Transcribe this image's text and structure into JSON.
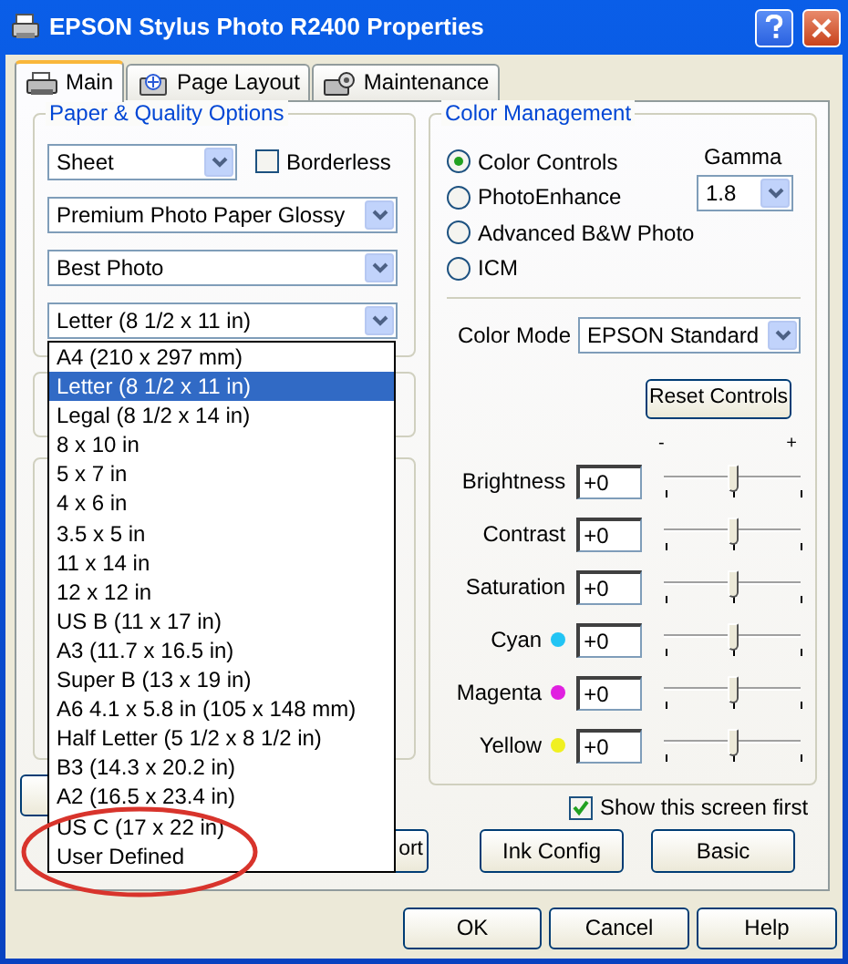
{
  "window": {
    "title": "EPSON Stylus Photo R2400 Properties"
  },
  "tabs": [
    {
      "label": "Main",
      "selected": true
    },
    {
      "label": "Page Layout",
      "selected": false
    },
    {
      "label": "Maintenance",
      "selected": false
    }
  ],
  "paper_quality": {
    "title": "Paper & Quality Options",
    "source": "Sheet",
    "borderless": {
      "label": "Borderless",
      "checked": false
    },
    "media_type": "Premium Photo Paper Glossy",
    "quality": "Best Photo",
    "paper_size": "Letter (8 1/2 x 11 in)",
    "paper_size_options": [
      {
        "label": "A4 (210 x 297 mm)",
        "selected": false
      },
      {
        "label": "Letter (8 1/2 x 11 in)",
        "selected": true
      },
      {
        "label": "Legal (8 1/2 x 14 in)",
        "selected": false
      },
      {
        "label": "8 x 10 in",
        "selected": false
      },
      {
        "label": "5 x 7 in",
        "selected": false
      },
      {
        "label": "4 x 6 in",
        "selected": false
      },
      {
        "label": "3.5 x 5 in",
        "selected": false
      },
      {
        "label": "11 x 14 in",
        "selected": false
      },
      {
        "label": "12 x 12 in",
        "selected": false
      },
      {
        "label": "US B (11 x 17 in)",
        "selected": false
      },
      {
        "label": "A3 (11.7 x 16.5 in)",
        "selected": false
      },
      {
        "label": "Super B (13 x 19 in)",
        "selected": false
      },
      {
        "label": "A6 4.1 x 5.8 in (105 x 148 mm)",
        "selected": false
      },
      {
        "label": "Half Letter (5 1/2 x 8 1/2 in)",
        "selected": false
      },
      {
        "label": "B3 (14.3 x 20.2 in)",
        "selected": false
      },
      {
        "label": "A2 (16.5 x 23.4 in)",
        "selected": false
      },
      {
        "label": "US C (17 x 22 in)",
        "selected": false
      },
      {
        "label": "User Defined",
        "selected": false
      }
    ]
  },
  "color_management": {
    "title": "Color Management",
    "modes": [
      {
        "label": "Color Controls",
        "selected": true
      },
      {
        "label": "PhotoEnhance",
        "selected": false
      },
      {
        "label": "Advanced B&W Photo",
        "selected": false
      },
      {
        "label": "ICM",
        "selected": false
      }
    ],
    "gamma_label": "Gamma",
    "gamma": "1.8",
    "color_mode_label": "Color Mode",
    "color_mode": "EPSON Standard",
    "reset_button": "Reset Controls",
    "scale_min": "-",
    "scale_max": "+",
    "adjustments": [
      {
        "label": "Brightness",
        "value": "+0",
        "level": 0.5
      },
      {
        "label": "Contrast",
        "value": "+0",
        "level": 0.5
      },
      {
        "label": "Saturation",
        "value": "+0",
        "level": 0.5
      },
      {
        "label": "Cyan",
        "value": "+0",
        "level": 0.5,
        "color": "#22c4f4"
      },
      {
        "label": "Magenta",
        "value": "+0",
        "level": 0.5,
        "color": "#e020e0"
      },
      {
        "label": "Yellow",
        "value": "+0",
        "level": 0.5,
        "color": "#f0f020"
      }
    ]
  },
  "show_first": {
    "label": "Show this screen first",
    "checked": true
  },
  "panel_buttons": [
    "ort",
    "Ink Config",
    "Basic"
  ],
  "dialog_buttons": [
    "OK",
    "Cancel",
    "Help"
  ]
}
